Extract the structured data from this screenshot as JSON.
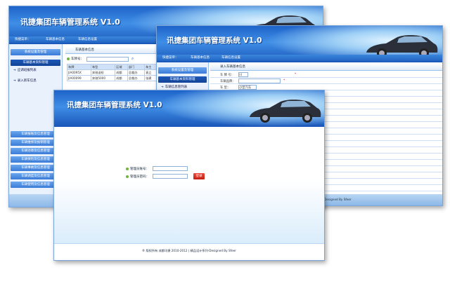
{
  "app_title": "讯捷集团车辆管理系统 V1.0",
  "nav": {
    "label": "快捷菜单：",
    "item1": "车辆基本信息",
    "item2": "车辆信息设置"
  },
  "sidebar": {
    "top_buttons": [
      "系统设置及管理",
      "车辆基本资料管理"
    ],
    "links": [
      "应调班报列表",
      "录入新车信息"
    ],
    "bottom_buttons": [
      "车辆报账及信息管理",
      "车辆维修及报销管理",
      "车辆违章及信息管理",
      "车辆保险及信息管理",
      "车辆事故及信息管理",
      "车辆调度及信息管理",
      "车辆使用及信息管理"
    ]
  },
  "win1": {
    "panel_title": "车辆基本信息",
    "search_label": "车牌号：",
    "columns": [
      "车牌",
      "车型",
      "区域",
      "部门",
      "车主",
      "单"
    ],
    "rows": [
      [
        "JIA0095X",
        "奔驰送检",
        "成都",
        "总裁办",
        "袁立",
        "0"
      ],
      [
        "JIA00099",
        "奔驰5000",
        "成都",
        "总裁办",
        "张建",
        "0"
      ]
    ]
  },
  "win2": {
    "sidebar_buttons": [
      "系统设置及管理",
      "车辆基本资料管理"
    ],
    "sidebar_link": "车辆信息管列表",
    "panel_title": "录入车辆基本信息",
    "fields": [
      {
        "label": "车 牌 号：",
        "value": "川"
      },
      {
        "label": "车辆品牌：",
        "value": ""
      },
      {
        "label": "车 型：",
        "value": "小型汽车"
      }
    ],
    "required_mark": "*",
    "footer": "Designed By Sfeer"
  },
  "login": {
    "username_label": "管理员账号：",
    "password_label": "管理员密码：",
    "submit_label": "登录",
    "footer": "® 版权所有 成都讯捷 2010-2012 | 精品设计系列-Designed By Sfeer"
  },
  "colors": {
    "header_blue": "#2a6fd1",
    "nav_blue": "#2165c3",
    "sidebar_bg": "#e8f1fc",
    "login_button": "#d22a1b",
    "bullet_green": "#6fb53c"
  }
}
